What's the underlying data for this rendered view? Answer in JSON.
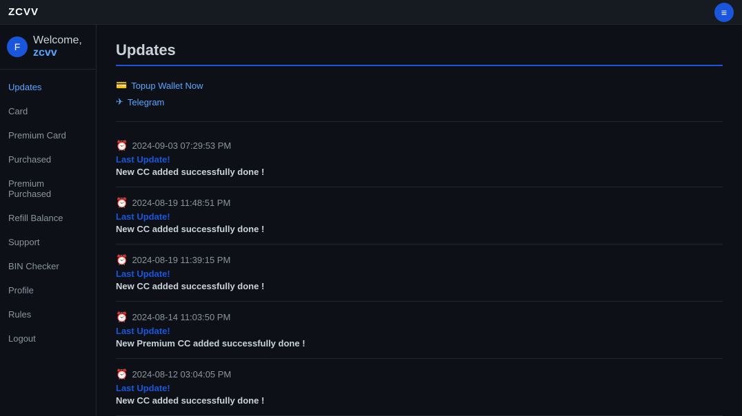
{
  "navbar": {
    "brand": "ZCVV",
    "menu_icon": "≡"
  },
  "sidebar": {
    "welcome_text": "Welcome,",
    "username": "zcvv",
    "avatar_icon": "F",
    "items": [
      {
        "label": "Updates",
        "active": true,
        "id": "updates"
      },
      {
        "label": "Card",
        "active": false,
        "id": "card"
      },
      {
        "label": "Premium Card",
        "active": false,
        "id": "premium-card"
      },
      {
        "label": "Purchased",
        "active": false,
        "id": "purchased"
      },
      {
        "label": "Premium Purchased",
        "active": false,
        "id": "premium-purchased"
      },
      {
        "label": "Refill Balance",
        "active": false,
        "id": "refill-balance"
      },
      {
        "label": "Support",
        "active": false,
        "id": "support"
      },
      {
        "label": "BIN Checker",
        "active": false,
        "id": "bin-checker"
      },
      {
        "label": "Profile",
        "active": false,
        "id": "profile"
      },
      {
        "label": "Rules",
        "active": false,
        "id": "rules"
      },
      {
        "label": "Logout",
        "active": false,
        "id": "logout"
      }
    ]
  },
  "main": {
    "title": "Updates",
    "action_links": [
      {
        "icon": "💳",
        "text": "Topup Wallet Now",
        "id": "topup"
      },
      {
        "icon": "✈",
        "text": "Telegram",
        "id": "telegram"
      }
    ],
    "updates": [
      {
        "timestamp": "2024-09-03 07:29:53 PM",
        "label": "Last Update!",
        "message": "New CC added successfully done !"
      },
      {
        "timestamp": "2024-08-19 11:48:51 PM",
        "label": "Last Update!",
        "message": "New CC added successfully done !"
      },
      {
        "timestamp": "2024-08-19 11:39:15 PM",
        "label": "Last Update!",
        "message": "New CC added successfully done !"
      },
      {
        "timestamp": "2024-08-14 11:03:50 PM",
        "label": "Last Update!",
        "message": "New Premium CC added successfully done !"
      },
      {
        "timestamp": "2024-08-12 03:04:05 PM",
        "label": "Last Update!",
        "message": "New CC added successfully done !"
      }
    ]
  }
}
